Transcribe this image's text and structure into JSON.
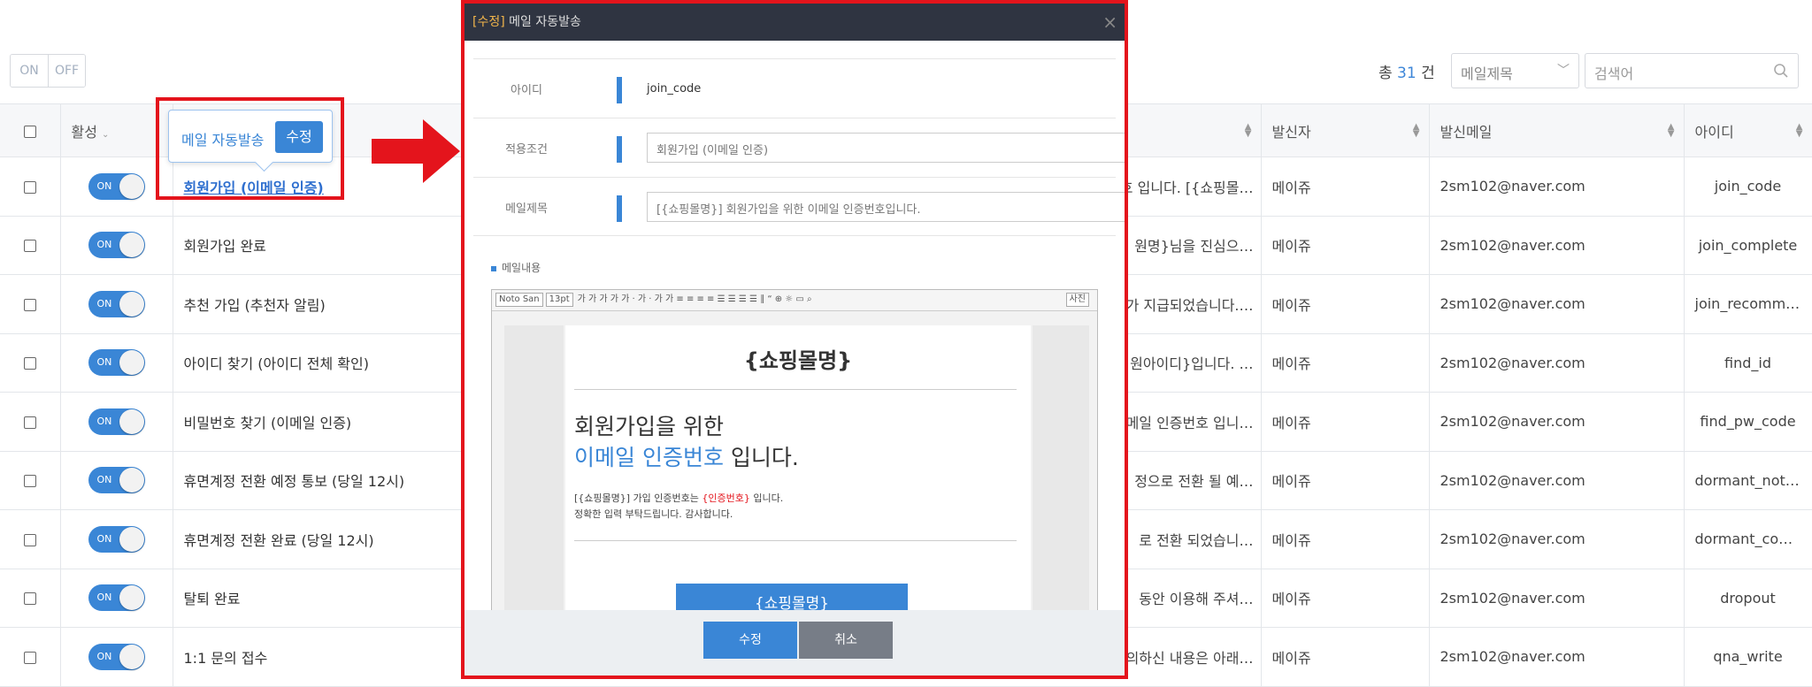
{
  "filters": {
    "on": "ON",
    "off": "OFF"
  },
  "summary": {
    "prefix": "총",
    "count": "31",
    "suffix": "건"
  },
  "search": {
    "field": "메일제목",
    "placeholder": "검색어"
  },
  "table": {
    "headers": [
      "활성",
      "",
      "발신자",
      "발신메일",
      "아이디"
    ],
    "rows": [
      {
        "toggle": "ON",
        "name": "회원가입 (이메일 인증)",
        "snippet": "호 입니다. [{쇼핑몰…",
        "sender": "메이쥬",
        "email": "2sm102@naver.com",
        "id": "join_code"
      },
      {
        "toggle": "ON",
        "name": "회원가입 완료",
        "snippet": "원명}님을 진심으…",
        "sender": "메이쥬",
        "email": "2sm102@naver.com",
        "id": "join_complete"
      },
      {
        "toggle": "ON",
        "name": "추천 가입 (추천자 알림)",
        "snippet": "가 지급되었습니다.…",
        "sender": "메이쥬",
        "email": "2sm102@naver.com",
        "id": "join_recomme…"
      },
      {
        "toggle": "ON",
        "name": "아이디 찾기 (아이디 전체 확인)",
        "snippet": "원아이디}입니다. …",
        "sender": "메이쥬",
        "email": "2sm102@naver.com",
        "id": "find_id"
      },
      {
        "toggle": "ON",
        "name": "비밀번호 찾기 (이메일 인증)",
        "snippet": "메일 인증번호 입니…",
        "sender": "메이쥬",
        "email": "2sm102@naver.com",
        "id": "find_pw_code"
      },
      {
        "toggle": "ON",
        "name": "휴면계정 전환 예정 통보 (당일 12시)",
        "snippet": "정으로 전환 될 예…",
        "sender": "메이쥬",
        "email": "2sm102@naver.com",
        "id": "dormant_notice"
      },
      {
        "toggle": "ON",
        "name": "휴면계정 전환 완료 (당일 12시)",
        "snippet": "로 전환 되었습니…",
        "sender": "메이쥬",
        "email": "2sm102@naver.com",
        "id": "dormant_com…"
      },
      {
        "toggle": "ON",
        "name": "탈퇴 완료",
        "snippet": "동안 이용해 주셔…",
        "sender": "메이쥬",
        "email": "2sm102@naver.com",
        "id": "dropout"
      },
      {
        "toggle": "ON",
        "name": "1:1 문의 접수",
        "snippet": "의하신 내용은 아래…",
        "sender": "메이쥬",
        "email": "2sm102@naver.com",
        "id": "qna_write"
      }
    ]
  },
  "bubble": {
    "title": "메일 자동발송",
    "button": "수정"
  },
  "modal": {
    "tag": "[수정]",
    "title": "메일 자동발송",
    "close": "×",
    "fields": {
      "id_label": "아이디",
      "id_value": "join_code",
      "cond_label": "적용조건",
      "cond_value": "회원가입 (이메일 인증)",
      "subject_label": "메일제목",
      "subject_value": "[{쇼핑몰명}] 회원가입을 위한 이메일 인증번호입니다."
    },
    "content_label": "메일내용",
    "toolbar": {
      "font": "Noto San",
      "size": "13pt",
      "source": "사진"
    },
    "preview": {
      "mall": "{쇼핑몰명}",
      "line1": "회원가입을 위한",
      "line2_blue": "이메일 인증번호",
      "line2_rest": " 입니다.",
      "p1_a": "[{쇼핑몰명}] 가입 인증번호는 ",
      "p1_red": "{인증번호}",
      "p1_b": " 입니다.",
      "p2": "정확한 입력 부탁드립니다. 감사합니다.",
      "button": "{쇼핑몰명}"
    },
    "save": "수정",
    "cancel": "취소"
  },
  "colors": {
    "accent": "#3a86d6",
    "highlight": "#e4141c",
    "modal_header": "#2f3441"
  }
}
